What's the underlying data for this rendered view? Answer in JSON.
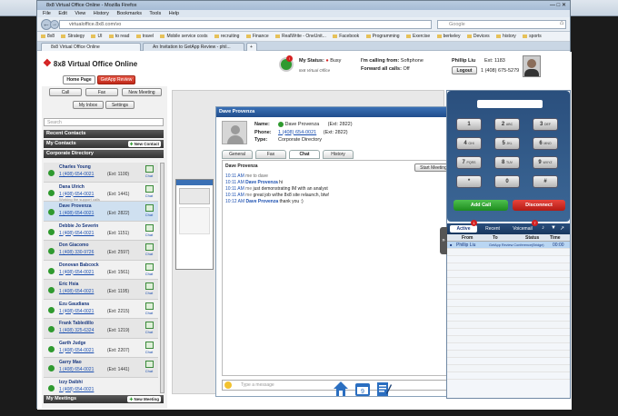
{
  "window": {
    "title": "8x8 Virtual Office Online - Mozilla Firefox",
    "menu": [
      "File",
      "Edit",
      "View",
      "History",
      "Bookmarks",
      "Tools",
      "Help"
    ],
    "url": "virtualoffice.8x8.com/vo",
    "search_placeholder": "Google",
    "bookmarks": [
      "8x8",
      "Strategy",
      "UI",
      "to read",
      "travel",
      "Mobile service costs",
      "recruiting",
      "Finance",
      "RealWrite - OneUnit...",
      "Facebook",
      "Programming",
      "Exercise",
      "berkeley",
      "Devices",
      "history",
      "sports"
    ],
    "tabs": [
      "8x8 Virtual Office Online",
      "An Invitation to GetApp Review - phil...",
      "+"
    ]
  },
  "app": {
    "logo_text": "8x8 Virtual Office Online",
    "home_tab": "Home Page",
    "review_tab": "GetApp Review",
    "my_status_label": "My Status:",
    "my_status_value": "Busy",
    "calling_from_label": "I'm calling from:",
    "calling_from_value": "Softphone",
    "forward_label": "Forward all calls:",
    "forward_value": "Off",
    "vo_caption": "8x8 Virtual Office",
    "user_name": "Phillip Liu",
    "user_ext": "Ext: 1183",
    "user_phone": "1 (408) 675-5279",
    "logout": "Logout"
  },
  "left": {
    "call": "Call",
    "fax": "Fax",
    "new_meeting": "New Meeting",
    "my_inbox": "My Inbox",
    "settings": "Settings",
    "search_placeholder": "Search",
    "recent_contacts": "Recent Contacts",
    "my_contacts": "My Contacts",
    "new_contact": "New Contact",
    "corporate_directory": "Corporate Directory",
    "my_meetings": "My Meetings",
    "new_meeting2": "New Meeting",
    "chat_label": "Chat",
    "contacts": [
      {
        "name": "Charles Young",
        "number": "1 (408) 654-0021",
        "ext": "(Ext: 1100)",
        "note": ""
      },
      {
        "name": "Dana Ulrich",
        "number": "1 (408) 654-0021",
        "ext": "(Ext: 1441)",
        "note": "Working the support calls"
      },
      {
        "name": "Dave Provenza",
        "number": "1 (408) 654-0021",
        "ext": "(Ext: 2822)",
        "note": ""
      },
      {
        "name": "Debbie Jo Severin",
        "number": "1 (408) 654-0021",
        "ext": "(Ext: 1151)",
        "note": ""
      },
      {
        "name": "Don Giacomo",
        "number": "1 (408) 330-9726",
        "ext": "(Ext: 2597)",
        "note": ""
      },
      {
        "name": "Donovan Babcock",
        "number": "1 (408) 654-0021",
        "ext": "(Ext: 1561)",
        "note": ""
      },
      {
        "name": "Eric Hsia",
        "number": "1 (408) 654-0021",
        "ext": "(Ext: 1195)",
        "note": ""
      },
      {
        "name": "Ezu Gaudiana",
        "number": "1 (408) 654-0021",
        "ext": "(Ext: 2215)",
        "note": ""
      },
      {
        "name": "Frank Tabledillo",
        "number": "1 (408) 325-6324",
        "ext": "(Ext: 1219)",
        "note": ""
      },
      {
        "name": "Garth Judge",
        "number": "1 (408) 654-0021",
        "ext": "(Ext: 2207)",
        "note": ""
      },
      {
        "name": "Garry Mao",
        "number": "1 (408) 654-0021",
        "ext": "(Ext: 1441)",
        "note": ""
      },
      {
        "name": "Izzy Daibhi",
        "number": "1 (408) 654-0021",
        "ext": "",
        "note": ""
      }
    ]
  },
  "chat": {
    "window_title": "Dave Provenza",
    "name_label": "Name:",
    "name_value": "Dave Provenza",
    "name_ext": "(Ext: 2822)",
    "phone_label": "Phone:",
    "phone_value": "1 (408) 654-0021",
    "phone_ext": "(Ext: 2822)",
    "type_label": "Type:",
    "type_value": "Corporate Directory",
    "tabs": [
      "General",
      "Fax",
      "Chat",
      "History"
    ],
    "heading": "Dave Provenza",
    "start_meeting": "Start Meeting",
    "messages": [
      {
        "time": "10:11 AM",
        "who": "me",
        "text": "to dave"
      },
      {
        "time": "10:11 AM",
        "who": "Dave Provenza",
        "text": "hi"
      },
      {
        "time": "10:11 AM",
        "who": "me",
        "text": "just demonstrating IM with an analyst"
      },
      {
        "time": "10:11 AM",
        "who": "me",
        "text": "great job w/the 8x8 site relaunch, btw!"
      },
      {
        "time": "10:12 AM",
        "who": "Dave Provenza",
        "text": "thank you :)"
      }
    ],
    "input_placeholder": "Type a message"
  },
  "dialer": {
    "keys": [
      {
        "d": "1",
        "s": ""
      },
      {
        "d": "2",
        "s": "ABC"
      },
      {
        "d": "3",
        "s": "DEF"
      },
      {
        "d": "4",
        "s": "GHI"
      },
      {
        "d": "5",
        "s": "JKL"
      },
      {
        "d": "6",
        "s": "MNO"
      },
      {
        "d": "7",
        "s": "PQRS"
      },
      {
        "d": "8",
        "s": "TUV"
      },
      {
        "d": "9",
        "s": "WXYZ"
      },
      {
        "d": "*",
        "s": ""
      },
      {
        "d": "0",
        "s": ""
      },
      {
        "d": "#",
        "s": ""
      }
    ],
    "add_call": "Add Call",
    "disconnect": "Disconnect",
    "tabs": [
      "Active",
      "Recent",
      "Voicemail"
    ],
    "active_badge": "1",
    "voicemail_badge": "7",
    "columns": [
      "From",
      "To",
      "Status",
      "Time"
    ],
    "rows": [
      {
        "from": "Phillip Liu",
        "to": "GetApp Review Conference(Bridge)",
        "status": "",
        "time": "00:00"
      }
    ]
  },
  "colors": {
    "accent_blue": "#1b4fb0",
    "status_green": "#2f9a2f",
    "busy_red": "#d42020",
    "header_dark": "#333333"
  }
}
